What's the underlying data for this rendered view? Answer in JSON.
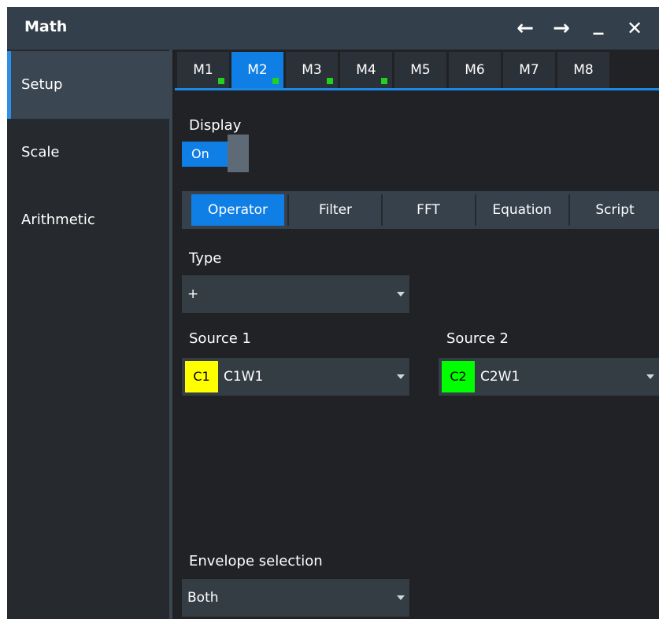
{
  "window": {
    "title": "Math",
    "buttons": {
      "back": "←",
      "forward": "→",
      "minimize": "_",
      "close": "✕"
    }
  },
  "sidebar": {
    "items": [
      {
        "label": "Setup",
        "active": true
      },
      {
        "label": "Scale",
        "active": false
      },
      {
        "label": "Arithmetic",
        "active": false
      }
    ]
  },
  "tabs": [
    {
      "label": "M1",
      "active": false,
      "indicator": true
    },
    {
      "label": "M2",
      "active": true,
      "indicator": true
    },
    {
      "label": "M3",
      "active": false,
      "indicator": true
    },
    {
      "label": "M4",
      "active": false,
      "indicator": true
    },
    {
      "label": "M5",
      "active": false,
      "indicator": false
    },
    {
      "label": "M6",
      "active": false,
      "indicator": false
    },
    {
      "label": "M7",
      "active": false,
      "indicator": false
    },
    {
      "label": "M8",
      "active": false,
      "indicator": false
    }
  ],
  "display": {
    "label": "Display",
    "state": "On"
  },
  "segments": [
    {
      "label": "Operator",
      "active": true
    },
    {
      "label": "Filter",
      "active": false
    },
    {
      "label": "FFT",
      "active": false
    },
    {
      "label": "Equation",
      "active": false
    },
    {
      "label": "Script",
      "active": false
    }
  ],
  "type": {
    "label": "Type",
    "value": "+"
  },
  "source1": {
    "label": "Source 1",
    "chip": "C1",
    "chip_color": "#ffff00",
    "value": "C1W1"
  },
  "source2": {
    "label": "Source 2",
    "chip": "C2",
    "chip_color": "#00ff00",
    "value": "C2W1"
  },
  "envelope": {
    "label": "Envelope selection",
    "value": "Both"
  },
  "colors": {
    "accent": "#0f7fe6",
    "indicator": "#22d01f",
    "background": "#202225"
  }
}
